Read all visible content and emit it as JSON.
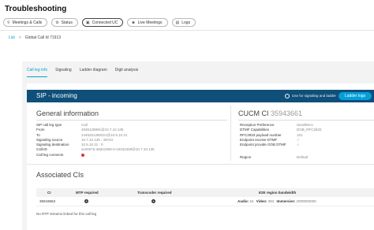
{
  "page": {
    "title": "Troubleshooting"
  },
  "toolbar": {
    "buttons": [
      {
        "label": "Meetings & Calls",
        "icon": "search-icon",
        "active": false
      },
      {
        "label": "Status",
        "icon": "gear-icon",
        "active": false
      },
      {
        "label": "Connected UC",
        "icon": "connected-uc-icon",
        "active": true
      },
      {
        "label": "Live Meetings",
        "icon": "people-icon",
        "active": false
      },
      {
        "label": "Logs",
        "icon": "document-icon",
        "active": false
      }
    ]
  },
  "breadcrumb": {
    "back": "List",
    "separator": ">",
    "current": "Global Call Id 71913"
  },
  "tabs": [
    "Call leg info",
    "Signaling",
    "Ladder diagram",
    "Digit analysis"
  ],
  "sip": {
    "title": "SIP - incoming",
    "toggle_label": "Use for signaling and ladder",
    "ladder_button": "Ladder logs"
  },
  "general": {
    "title": "General information",
    "rows": [
      {
        "key": "SIP call leg type",
        "value": "Call"
      },
      {
        "key": "From",
        "value": "4935128991@10.7.10.135"
      },
      {
        "key": "To",
        "value": "1445251280021@10.5.10.31"
      },
      {
        "key": "Signaling source",
        "value": "10.7.10.135 : 49743"
      },
      {
        "key": "Signaling destination",
        "value": "10.5.10.31 : 0"
      },
      {
        "key": "Call-ID",
        "value": "ac0007a-38d41906-0-10042469@10.7.10.135"
      },
      {
        "key": "Call leg connects",
        "value": ""
      }
    ]
  },
  "cucm": {
    "title": "CUCM CI",
    "number": "35943661",
    "rows": [
      {
        "key": "Reception Preference",
        "value": "SendRecv"
      },
      {
        "key": "DTMF Capabilities",
        "value": "DOB_RFC2833"
      },
      {
        "key": "RFC2833 payload number",
        "value": "101"
      },
      {
        "key": "Endpoint receive DTMF",
        "value": "✓"
      },
      {
        "key": "Endpoint provide OOB DTMF",
        "value": "✓"
      }
    ],
    "region_key": "Region",
    "region_value": "Default"
  },
  "associated": {
    "title": "Associated CIs",
    "columns": [
      "CI",
      "MTP required",
      "Transcoder required",
      "E2E region bandwidth"
    ],
    "rows": [
      {
        "ci": "35943663",
        "audio_label": "Audio:",
        "audio_value": "64",
        "video_label": "Video:",
        "video_value": "384",
        "immersive_label": "Immersive:",
        "immersive_value": "2000000000"
      }
    ]
  },
  "no_rtp": "No RTP streams linked for this call leg",
  "colors": {
    "header": "#0f4f7a",
    "accent": "#049fd9",
    "error": "#d9382f",
    "ok": "#7fae42"
  }
}
